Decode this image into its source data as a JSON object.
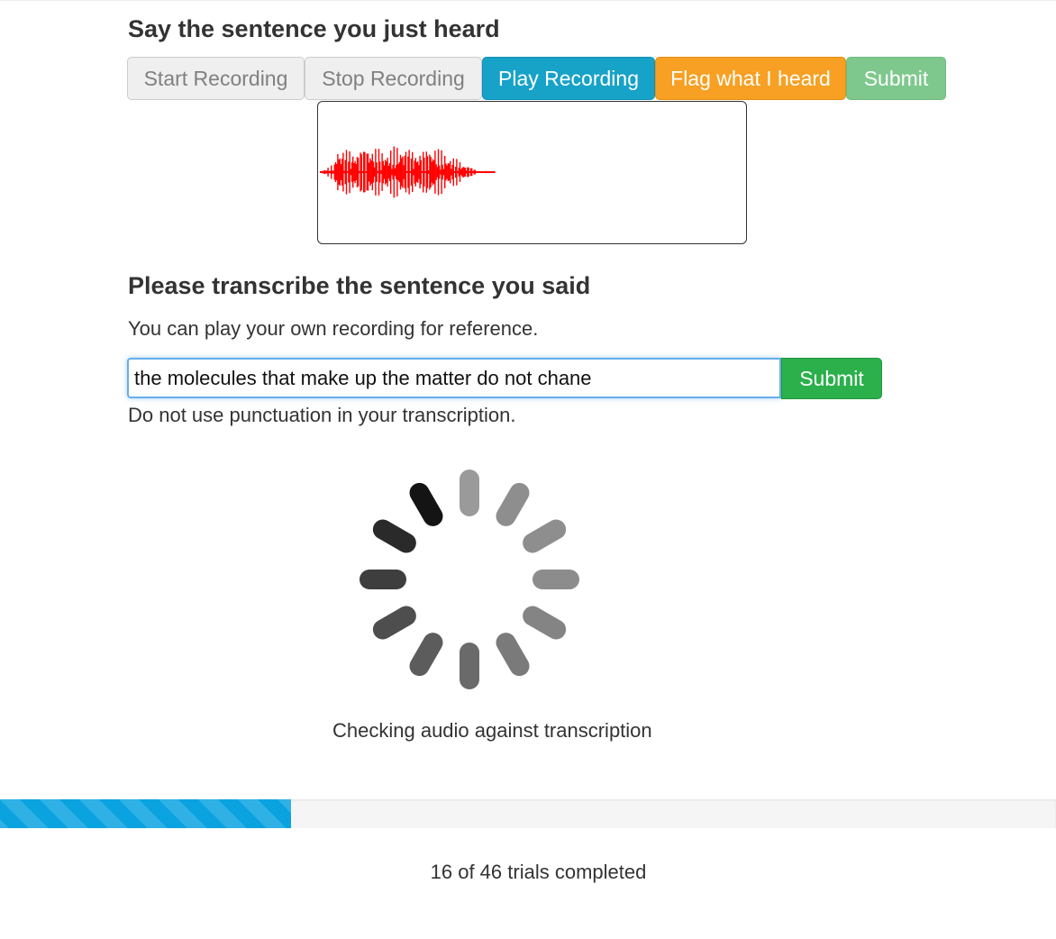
{
  "record_section": {
    "heading": "Say the sentence you just heard",
    "buttons": {
      "start": "Start Recording",
      "stop": "Stop Recording",
      "play": "Play Recording",
      "flag": "Flag what I heard",
      "submit": "Submit"
    },
    "waveform_color": "#ff0000"
  },
  "transcribe_section": {
    "heading": "Please transcribe the sentence you said",
    "help_text": "You can play your own recording for reference.",
    "input_value": "the molecules that make up the matter do not chane",
    "submit": "Submit",
    "note": "Do not use punctuation in your transcription."
  },
  "status": {
    "spinner_icon": "loading-spinner-icon",
    "text": "Checking audio against transcription"
  },
  "progress": {
    "completed": 16,
    "total": 46,
    "fraction": 0.2754,
    "bar_color": "#0aa3e0",
    "text": "16 of 46 trials completed"
  }
}
